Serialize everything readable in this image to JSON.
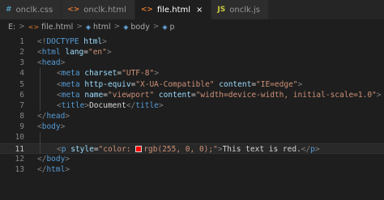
{
  "tabs": [
    {
      "label": "onclk.css",
      "icon": "css-file-icon",
      "active": false
    },
    {
      "label": "onclk.html",
      "icon": "html-file-icon",
      "active": false
    },
    {
      "label": "file.html",
      "icon": "html-file-icon",
      "active": true,
      "close": "×"
    },
    {
      "label": "onclk.js",
      "icon": "js-file-icon",
      "icon_text": "JS",
      "active": false
    }
  ],
  "breadcrumb": {
    "drive": "E:",
    "sep": ">",
    "file": "file.html",
    "html": "html",
    "body": "body",
    "p": "p"
  },
  "editor": {
    "current_line": 11,
    "lines": [
      {
        "n": "1",
        "s": [
          "<!",
          "DOCTYPE",
          " ",
          "html",
          ">"
        ]
      },
      {
        "n": "2",
        "s": [
          "<",
          "html",
          " ",
          "lang",
          "=",
          "\"en\"",
          ">"
        ]
      },
      {
        "n": "3",
        "s": [
          "<",
          "head",
          ">"
        ]
      },
      {
        "n": "4",
        "s": [
          "<",
          "meta",
          " ",
          "charset",
          "=",
          "\"UTF-8\"",
          ">"
        ]
      },
      {
        "n": "5",
        "s": [
          "<",
          "meta",
          " ",
          "http-equiv",
          "=",
          "\"X-UA-Compatible\"",
          " ",
          "content",
          "=",
          "\"IE=edge\"",
          ">"
        ]
      },
      {
        "n": "6",
        "s": [
          "<",
          "meta",
          " ",
          "name",
          "=",
          "\"viewport\"",
          " ",
          "content",
          "=",
          "\"width=device-width, initial-scale=1.0\"",
          ">"
        ]
      },
      {
        "n": "7",
        "s": [
          "<",
          "title",
          ">",
          "Document",
          "</",
          "title",
          ">"
        ]
      },
      {
        "n": "8",
        "s": [
          "</",
          "head",
          ">"
        ]
      },
      {
        "n": "9",
        "s": [
          "<",
          "body",
          ">"
        ]
      },
      {
        "n": "10",
        "s": []
      },
      {
        "n": "11",
        "s": [
          "<",
          "p",
          " ",
          "style",
          "=",
          "\"color: ",
          "rgb(255, 0, 0);\"",
          ">",
          "This text is red.",
          "</",
          "p",
          ">"
        ],
        "swatch": "#ff0000"
      },
      {
        "n": "12",
        "s": [
          "</",
          "body",
          ">"
        ]
      },
      {
        "n": "13",
        "s": [
          "</",
          "html",
          ">"
        ]
      }
    ]
  }
}
